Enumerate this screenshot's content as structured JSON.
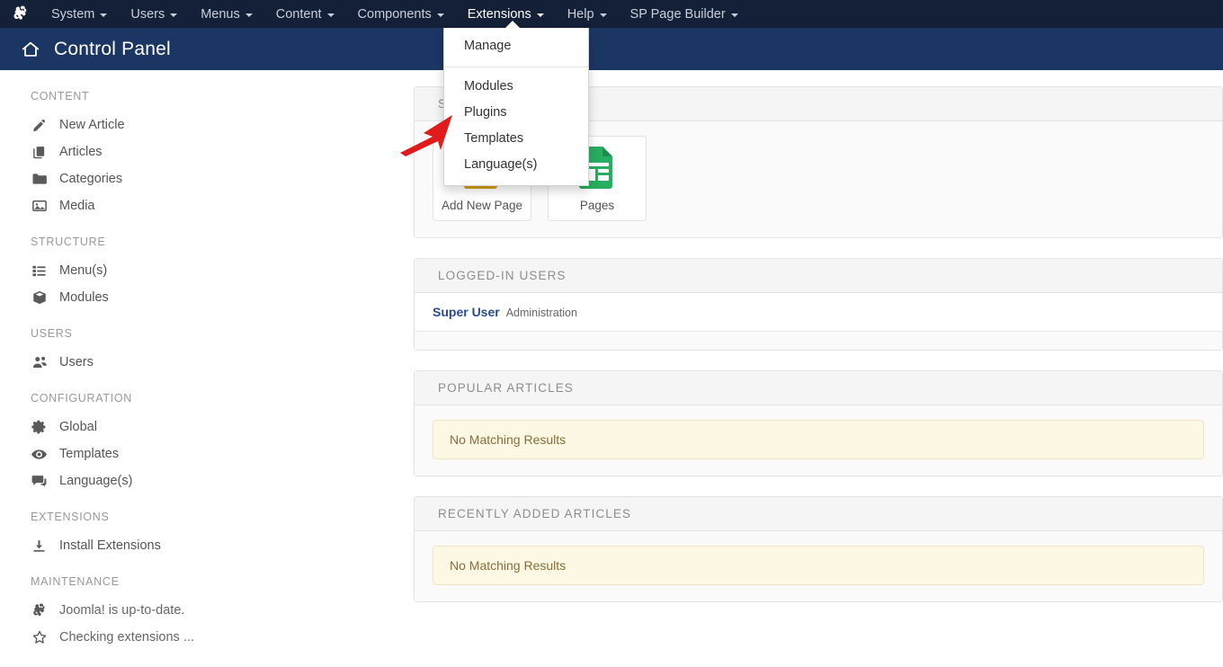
{
  "topbar": {
    "logo_icon": "joomla-logo-icon",
    "menus": [
      {
        "label": "System",
        "has_caret": true,
        "active": false
      },
      {
        "label": "Users",
        "has_caret": true,
        "active": false
      },
      {
        "label": "Menus",
        "has_caret": true,
        "active": false
      },
      {
        "label": "Content",
        "has_caret": true,
        "active": false
      },
      {
        "label": "Components",
        "has_caret": true,
        "active": false
      },
      {
        "label": "Extensions",
        "has_caret": true,
        "active": true
      },
      {
        "label": "Help",
        "has_caret": true,
        "active": false
      },
      {
        "label": "SP Page Builder",
        "has_caret": true,
        "active": false
      }
    ],
    "bar_color": "#142038"
  },
  "dropdown": {
    "open_for": "Extensions",
    "groups": [
      {
        "items": [
          {
            "label": "Manage"
          }
        ]
      },
      {
        "items": [
          {
            "label": "Modules"
          },
          {
            "label": "Plugins"
          },
          {
            "label": "Templates"
          },
          {
            "label": "Language(s)"
          }
        ]
      }
    ]
  },
  "titlebar": {
    "home_icon": "home-icon",
    "title": "Control Panel",
    "bar_color": "#1c3664"
  },
  "sidebar": {
    "groups": [
      {
        "title": "CONTENT",
        "items": [
          {
            "label": "New Article",
            "icon": "pencil-icon"
          },
          {
            "label": "Articles",
            "icon": "copy-icon"
          },
          {
            "label": "Categories",
            "icon": "folder-icon"
          },
          {
            "label": "Media",
            "icon": "image-icon"
          }
        ]
      },
      {
        "title": "STRUCTURE",
        "items": [
          {
            "label": "Menu(s)",
            "icon": "list-icon"
          },
          {
            "label": "Modules",
            "icon": "cube-icon"
          }
        ]
      },
      {
        "title": "USERS",
        "items": [
          {
            "label": "Users",
            "icon": "users-icon"
          }
        ]
      },
      {
        "title": "CONFIGURATION",
        "items": [
          {
            "label": "Global",
            "icon": "gear-icon"
          },
          {
            "label": "Templates",
            "icon": "eye-icon"
          },
          {
            "label": "Language(s)",
            "icon": "comment-icon"
          }
        ]
      },
      {
        "title": "EXTENSIONS",
        "items": [
          {
            "label": "Install Extensions",
            "icon": "download-icon"
          }
        ]
      },
      {
        "title": "MAINTENANCE",
        "items": [
          {
            "label": "Joomla! is up-to-date.",
            "icon": "joomla-logo-icon"
          },
          {
            "label": "Checking extensions ...",
            "icon": "star-icon"
          }
        ]
      }
    ]
  },
  "panels": {
    "page_builder": {
      "title": "SP PAGE BUILDER",
      "tiles": [
        {
          "label": "Add New Page",
          "icon": "add-page-icon",
          "color": "#d4a017"
        },
        {
          "label": "Pages",
          "icon": "pages-icon",
          "color": "#27ae60"
        }
      ]
    },
    "logged_in_users": {
      "title": "LOGGED-IN USERS",
      "rows": [
        {
          "name": "Super User",
          "role": "Administration"
        }
      ]
    },
    "popular_articles": {
      "title": "POPULAR ARTICLES",
      "empty_message": "No Matching Results"
    },
    "recently_added_articles": {
      "title": "RECENTLY ADDED ARTICLES",
      "empty_message": "No Matching Results"
    }
  },
  "annotation": {
    "arrow": {
      "name": "red-arrow-pointer",
      "color": "#e01b1b",
      "points_to": "Templates"
    }
  }
}
